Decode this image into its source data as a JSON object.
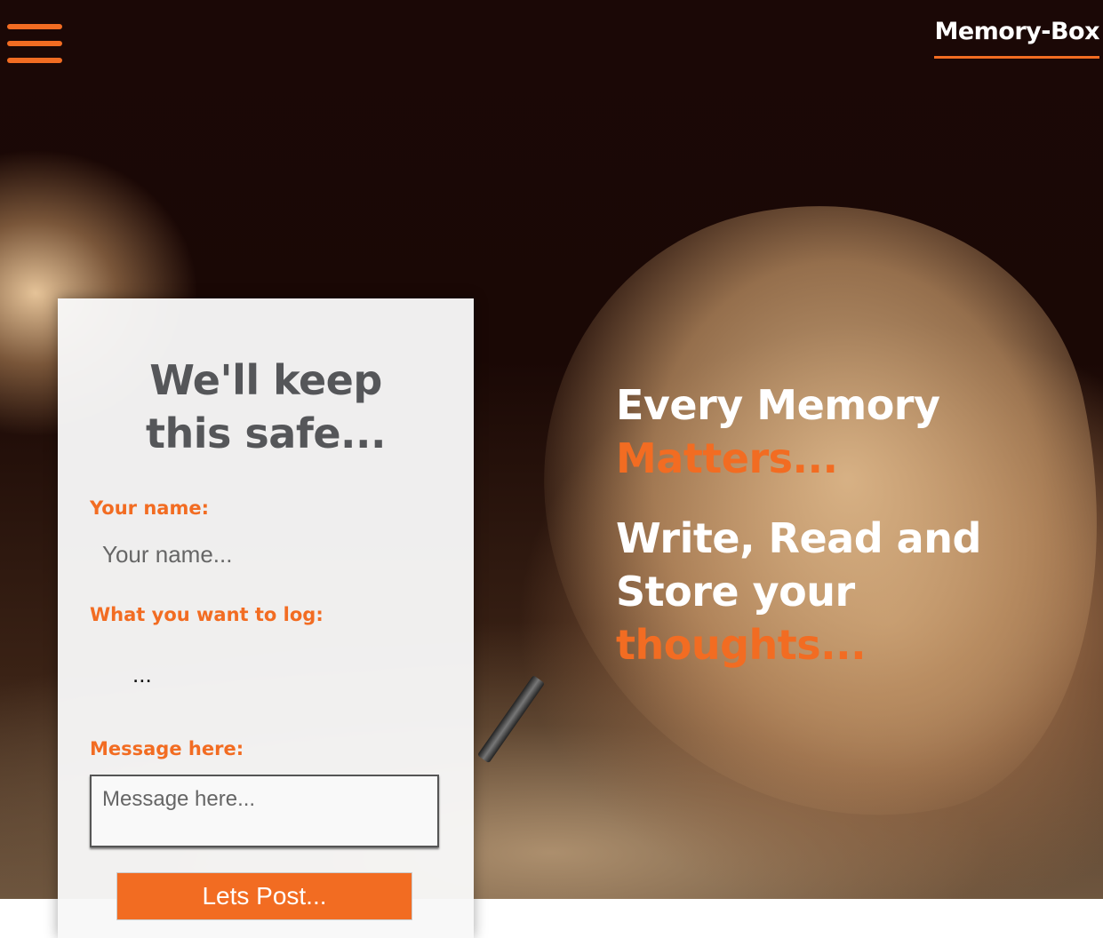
{
  "header": {
    "brand": "Memory-Box",
    "menu_icon": "hamburger-menu-icon",
    "accent_color": "#f26c22"
  },
  "hero": {
    "line1": "Every Memory",
    "line1_accent": "Matters...",
    "line2": "Write, Read and Store your",
    "line2_accent": "thoughts..."
  },
  "form": {
    "title": "We'll keep this safe...",
    "name_label": "Your name:",
    "name_placeholder": "Your name...",
    "log_label": "What you want to log:",
    "log_value": "...",
    "message_label": "Message here:",
    "message_placeholder": "Message here...",
    "submit_label": "Lets Post..."
  }
}
